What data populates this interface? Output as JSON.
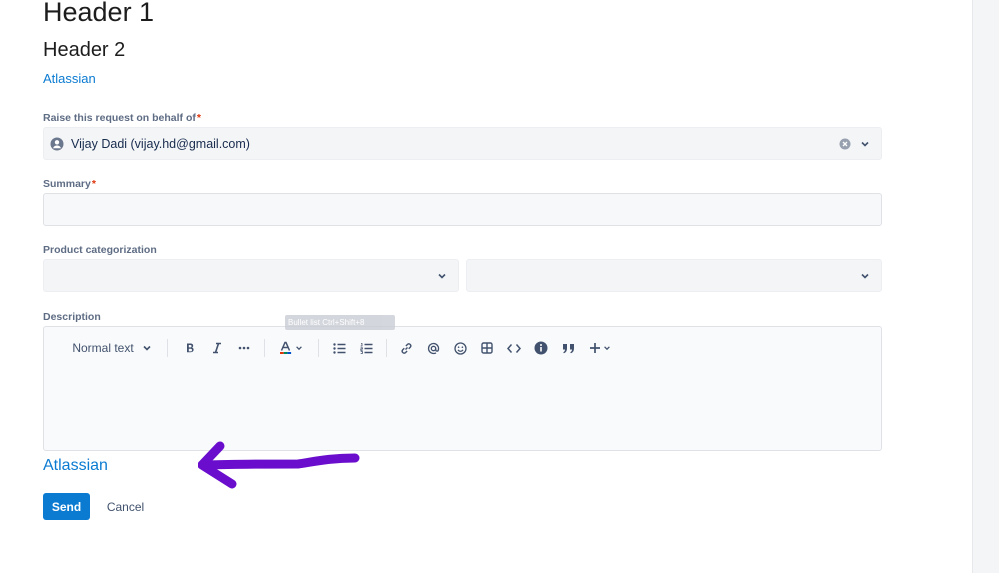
{
  "headings": {
    "h1": "Header 1",
    "h2": "Header 2"
  },
  "links": {
    "top": "Atlassian",
    "bottom": "Atlassian"
  },
  "form": {
    "behalf": {
      "label": "Raise this request on behalf of",
      "required": "*",
      "value": "Vijay Dadi (vijay.hd@gmail.com)"
    },
    "summary": {
      "label": "Summary",
      "required": "*",
      "value": ""
    },
    "product": {
      "label": "Product categorization"
    },
    "description": {
      "label": "Description",
      "toolbar": {
        "text_style": "Normal text"
      },
      "tooltip": "Bullet list  Ctrl+Shift+8"
    }
  },
  "buttons": {
    "send": "Send",
    "cancel": "Cancel"
  },
  "icons": [
    "user-avatar-icon",
    "clear-icon",
    "chevron-down-icon",
    "bold-icon",
    "italic-icon",
    "more-icon",
    "text-color-icon",
    "bullet-list-icon",
    "numbered-list-icon",
    "link-icon",
    "mention-icon",
    "emoji-icon",
    "table-icon",
    "code-icon",
    "info-icon",
    "quote-icon",
    "insert-icon"
  ],
  "colors": {
    "accent": "#0b7bd1",
    "annotation_arrow": "#6a0dcd",
    "required": "#de350b"
  }
}
